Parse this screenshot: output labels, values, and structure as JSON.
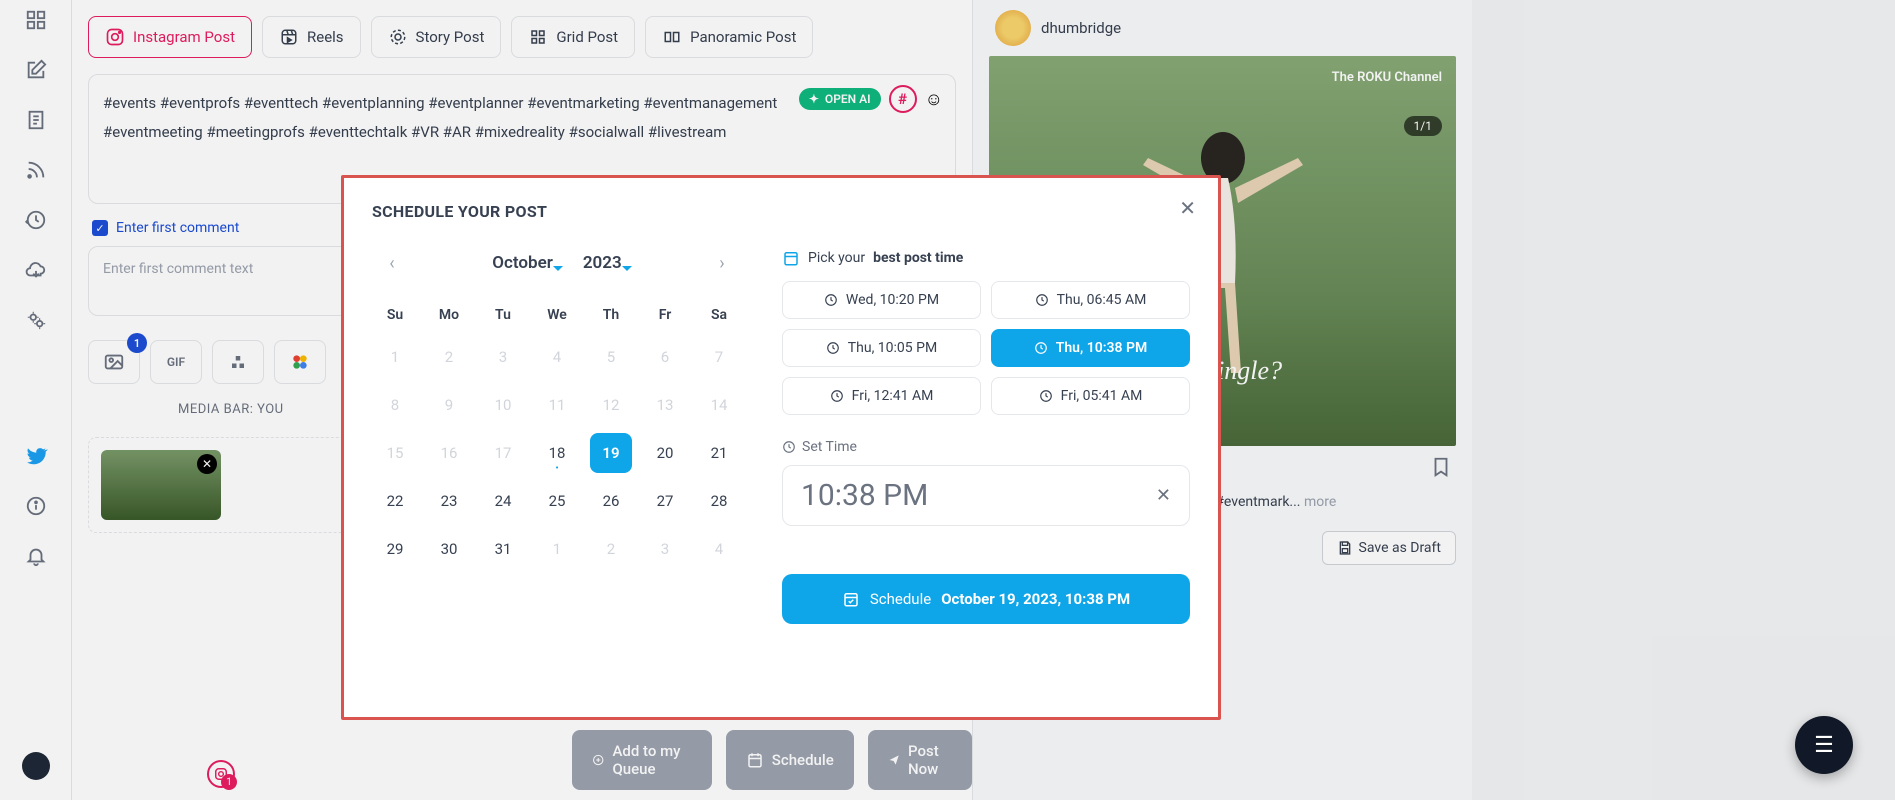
{
  "sidebar": {
    "icons": [
      "dashboard",
      "compose",
      "document",
      "feed",
      "history",
      "upload",
      "settings",
      "twitter",
      "info",
      "bell"
    ]
  },
  "tabs": {
    "instagram": "Instagram Post",
    "reels": "Reels",
    "story": "Story Post",
    "grid": "Grid Post",
    "panoramic": "Panoramic Post"
  },
  "compose": {
    "openai_label": "OPEN AI",
    "text": "#events #eventprofs #eventtech #eventplanning #eventplanner #eventmarketing #eventmanagement #eventmeeting #meetingprofs #eventtechtalk #VR #AR #mixedreality #socialwall #livestream",
    "first_comment_check": "Enter first comment",
    "first_comment_placeholder": "Enter first comment text",
    "media_count": "1",
    "media_bar_label": "MEDIA BAR: YOU"
  },
  "ig_badge_count": "1",
  "actions": {
    "queue": "Add to my Queue",
    "schedule": "Schedule",
    "postnow": "Post Now"
  },
  "preview": {
    "username": "dhumbridge",
    "roku": "The ROKU Channel",
    "counter": "1/1",
    "overlay": "you single?",
    "caption": "s #eventprofs #eventtech ntplanner #eventmark...",
    "more": "more",
    "save_draft": "Save as Draft"
  },
  "modal": {
    "title": "SCHEDULE YOUR POST",
    "month": "October",
    "year": "2023",
    "dow": [
      "Su",
      "Mo",
      "Tu",
      "We",
      "Th",
      "Fr",
      "Sa"
    ],
    "days": [
      {
        "n": "1",
        "muted": true
      },
      {
        "n": "2",
        "muted": true
      },
      {
        "n": "3",
        "muted": true
      },
      {
        "n": "4",
        "muted": true
      },
      {
        "n": "5",
        "muted": true
      },
      {
        "n": "6",
        "muted": true
      },
      {
        "n": "7",
        "muted": true
      },
      {
        "n": "8",
        "muted": true
      },
      {
        "n": "9",
        "muted": true
      },
      {
        "n": "10",
        "muted": true
      },
      {
        "n": "11",
        "muted": true
      },
      {
        "n": "12",
        "muted": true
      },
      {
        "n": "13",
        "muted": true
      },
      {
        "n": "14",
        "muted": true
      },
      {
        "n": "15",
        "muted": true
      },
      {
        "n": "16",
        "muted": true
      },
      {
        "n": "17",
        "muted": true
      },
      {
        "n": "18",
        "dot": true
      },
      {
        "n": "19",
        "selected": true
      },
      {
        "n": "20"
      },
      {
        "n": "21"
      },
      {
        "n": "22"
      },
      {
        "n": "23"
      },
      {
        "n": "24"
      },
      {
        "n": "25"
      },
      {
        "n": "26"
      },
      {
        "n": "27"
      },
      {
        "n": "28"
      },
      {
        "n": "29"
      },
      {
        "n": "30"
      },
      {
        "n": "31"
      },
      {
        "n": "1",
        "muted": true
      },
      {
        "n": "2",
        "muted": true
      },
      {
        "n": "3",
        "muted": true
      },
      {
        "n": "4",
        "muted": true
      }
    ],
    "best_time_prefix": "Pick your",
    "best_time_bold": "best post time",
    "slots": [
      {
        "label": "Wed, 10:20 PM"
      },
      {
        "label": "Thu, 06:45 AM"
      },
      {
        "label": "Thu, 10:05 PM"
      },
      {
        "label": "Thu, 10:38 PM",
        "active": true
      },
      {
        "label": "Fri, 12:41 AM"
      },
      {
        "label": "Fri, 05:41 AM"
      }
    ],
    "set_time_label": "Set Time",
    "time_value": "10:38 PM",
    "schedule_label": "Schedule",
    "schedule_datetime": "October 19, 2023, 10:38 PM"
  }
}
